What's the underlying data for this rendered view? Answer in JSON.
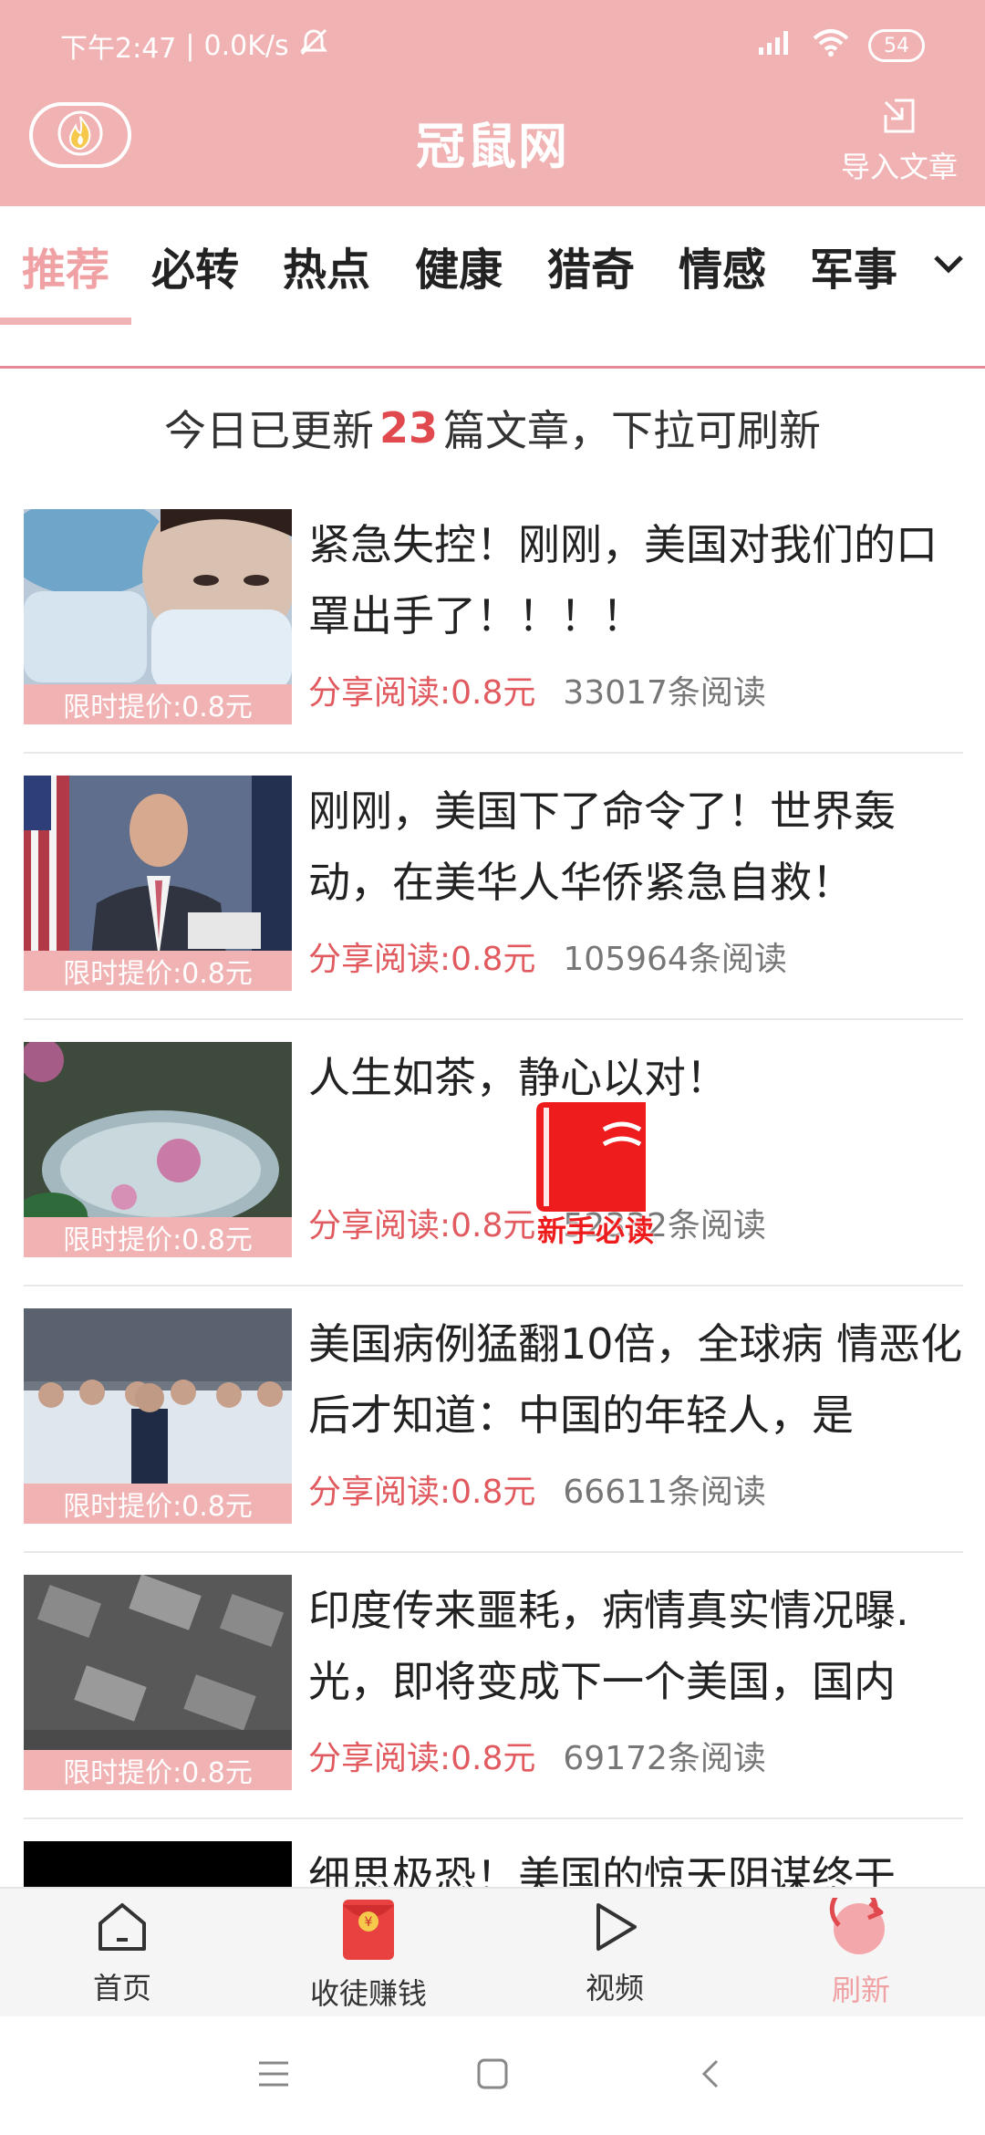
{
  "status_bar": {
    "time": "下午2:47",
    "network_speed": "0.0K/s",
    "battery": "54"
  },
  "header": {
    "title": "冠鼠网",
    "import_label": "导入文章"
  },
  "tabs": [
    {
      "label": "推荐",
      "active": true
    },
    {
      "label": "必转",
      "active": false
    },
    {
      "label": "热点",
      "active": false
    },
    {
      "label": "健康",
      "active": false
    },
    {
      "label": "猎奇",
      "active": false
    },
    {
      "label": "情感",
      "active": false
    },
    {
      "label": "军事",
      "active": false
    }
  ],
  "notice": {
    "prefix": "今日已更新",
    "count": "23",
    "suffix": "篇文章，下拉可刷新"
  },
  "articles": [
    {
      "title": "紧急失控！刚刚，美国对我们的口罩出手了！！！！",
      "badge": "限时提价:0.8元",
      "price": "分享阅读:0.8元",
      "reads": "33017条阅读"
    },
    {
      "title": "刚刚，美国下了命令了！世界轰动，在美华人华侨紧急自救！",
      "badge": "限时提价:0.8元",
      "price": "分享阅读:0.8元",
      "reads": "105964条阅读"
    },
    {
      "title": "人生如茶，静心以对！",
      "badge": "限时提价:0.8元",
      "price": "分享阅读:0.8元",
      "reads": "52332条阅读"
    },
    {
      "title": "美国病例猛翻10倍，全球病 情恶化后才知道：中国的年轻人，是",
      "badge": "限时提价:0.8元",
      "price": "分享阅读:0.8元",
      "reads": "66611条阅读"
    },
    {
      "title": "印度传来噩耗，病情真实情况曝.光，即将变成下一个美国，国内",
      "badge": "限时提价:0.8元",
      "price": "分享阅读:0.8元",
      "reads": "69172条阅读"
    },
    {
      "title": "细思极恐！美国的惊天阴谋终于",
      "badge": "",
      "price": "",
      "reads": ""
    }
  ],
  "float_button": {
    "label": "新手必读"
  },
  "bottom_nav": [
    {
      "label": "首页",
      "icon": "home-icon"
    },
    {
      "label": "收徒赚钱",
      "icon": "red-envelope-icon"
    },
    {
      "label": "视频",
      "icon": "play-icon"
    },
    {
      "label": "刷新",
      "icon": "refresh-icon",
      "active": true
    }
  ],
  "colors": {
    "header_pink": "#f1b2b3",
    "accent_red": "#e04a4f",
    "price_red": "#e15a5f"
  }
}
